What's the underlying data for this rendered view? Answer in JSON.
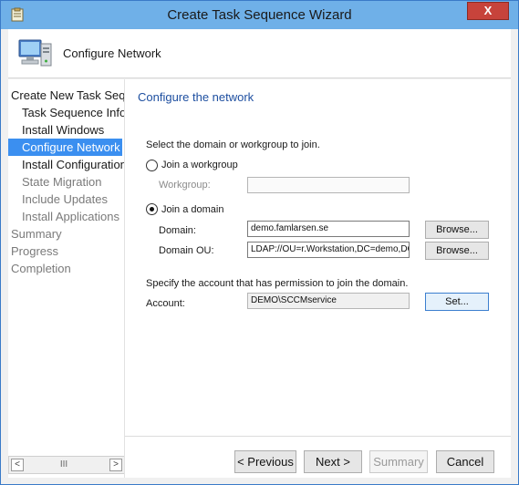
{
  "window": {
    "title": "Create Task Sequence Wizard",
    "close_label": "X"
  },
  "header": {
    "title": "Configure Network"
  },
  "nav": {
    "items": [
      {
        "label": "Create New Task Sequ",
        "state": "normal"
      },
      {
        "label": "Task Sequence Infor",
        "state": "normal"
      },
      {
        "label": "Install Windows",
        "state": "normal"
      },
      {
        "label": "Configure Network",
        "state": "selected"
      },
      {
        "label": "Install Configuration",
        "state": "normal"
      },
      {
        "label": "State Migration",
        "state": "disabled"
      },
      {
        "label": "Include Updates",
        "state": "disabled"
      },
      {
        "label": "Install Applications",
        "state": "disabled"
      },
      {
        "label": "Summary",
        "state": "disabled"
      },
      {
        "label": "Progress",
        "state": "disabled"
      },
      {
        "label": "Completion",
        "state": "disabled"
      }
    ],
    "scroll_left": "<",
    "scroll_thumb": "III",
    "scroll_right": ">"
  },
  "main": {
    "title": "Configure the network",
    "select_prompt": "Select the domain or workgroup to join.",
    "workgroup_radio_label": "Join a workgroup",
    "workgroup_field_label": "Workgroup:",
    "workgroup_value": "",
    "domain_radio_label": "Join a domain",
    "domain_label": "Domain:",
    "domain_value": "demo.famlarsen.se",
    "domain_browse": "Browse...",
    "ou_label": "Domain OU:",
    "ou_value": "LDAP://OU=r.Workstation,DC=demo,DC=fam",
    "ou_browse": "Browse...",
    "account_prompt": "Specify the account that has permission to join the domain.",
    "account_label": "Account:",
    "account_value": "DEMO\\SCCMservice",
    "set_label": "Set..."
  },
  "footer": {
    "previous": "< Previous",
    "next": "Next >",
    "summary": "Summary",
    "cancel": "Cancel"
  }
}
